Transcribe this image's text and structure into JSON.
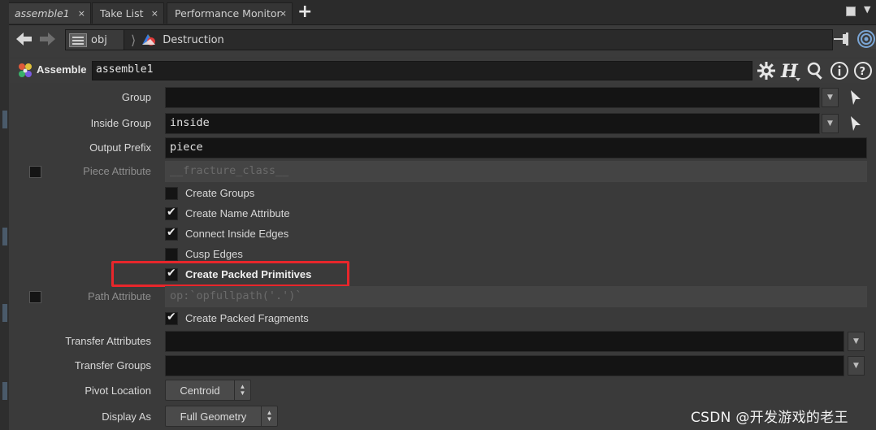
{
  "tabs": [
    {
      "label": "assemble1",
      "close": "×"
    },
    {
      "label": "Take List",
      "close": "×"
    },
    {
      "label": "Performance Monitor",
      "close": "×"
    }
  ],
  "tab_add": "+",
  "path": {
    "root": "obj",
    "network": "Destruction"
  },
  "node": {
    "type": "Assemble",
    "name": "assemble1"
  },
  "params": {
    "group": {
      "label": "Group",
      "value": ""
    },
    "inside_group": {
      "label": "Inside Group",
      "value": "inside"
    },
    "output_prefix": {
      "label": "Output Prefix",
      "value": "piece"
    },
    "piece_attribute": {
      "label": "Piece Attribute",
      "value": "__fracture_class__",
      "enabled": false
    },
    "checkboxes": [
      {
        "label": "Create Groups",
        "checked": false
      },
      {
        "label": "Create Name Attribute",
        "checked": true
      },
      {
        "label": "Connect Inside Edges",
        "checked": true
      },
      {
        "label": "Cusp Edges",
        "checked": false
      },
      {
        "label": "Create Packed Primitives",
        "checked": true,
        "highlighted": true
      }
    ],
    "path_attribute": {
      "label": "Path Attribute",
      "value": "op:`opfullpath('.')`",
      "enabled": false
    },
    "create_packed_fragments": {
      "label": "Create Packed Fragments",
      "checked": true
    },
    "transfer_attributes": {
      "label": "Transfer Attributes",
      "value": ""
    },
    "transfer_groups": {
      "label": "Transfer Groups",
      "value": ""
    },
    "pivot_location": {
      "label": "Pivot Location",
      "value": "Centroid"
    },
    "display_as": {
      "label": "Display As",
      "value": "Full Geometry"
    }
  },
  "colors": {
    "highlight": "#e8262b",
    "field_bg": "#141414",
    "panel_bg": "#3a3a3a"
  },
  "watermark": "CSDN @开发游戏的老王"
}
